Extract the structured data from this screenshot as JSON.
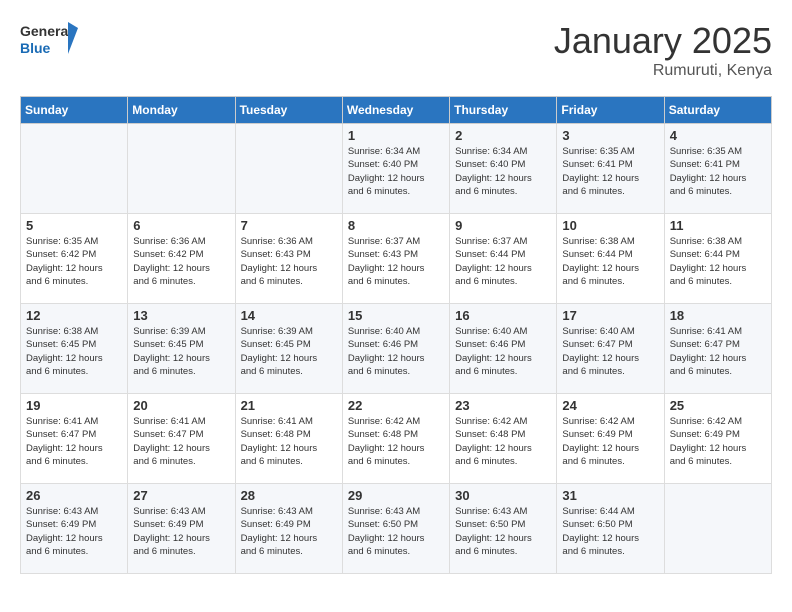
{
  "header": {
    "logo_line1": "General",
    "logo_line2": "Blue",
    "month": "January 2025",
    "location": "Rumuruti, Kenya"
  },
  "days_of_week": [
    "Sunday",
    "Monday",
    "Tuesday",
    "Wednesday",
    "Thursday",
    "Friday",
    "Saturday"
  ],
  "weeks": [
    [
      {
        "day": "",
        "info": ""
      },
      {
        "day": "",
        "info": ""
      },
      {
        "day": "",
        "info": ""
      },
      {
        "day": "1",
        "info": "Sunrise: 6:34 AM\nSunset: 6:40 PM\nDaylight: 12 hours\nand 6 minutes."
      },
      {
        "day": "2",
        "info": "Sunrise: 6:34 AM\nSunset: 6:40 PM\nDaylight: 12 hours\nand 6 minutes."
      },
      {
        "day": "3",
        "info": "Sunrise: 6:35 AM\nSunset: 6:41 PM\nDaylight: 12 hours\nand 6 minutes."
      },
      {
        "day": "4",
        "info": "Sunrise: 6:35 AM\nSunset: 6:41 PM\nDaylight: 12 hours\nand 6 minutes."
      }
    ],
    [
      {
        "day": "5",
        "info": "Sunrise: 6:35 AM\nSunset: 6:42 PM\nDaylight: 12 hours\nand 6 minutes."
      },
      {
        "day": "6",
        "info": "Sunrise: 6:36 AM\nSunset: 6:42 PM\nDaylight: 12 hours\nand 6 minutes."
      },
      {
        "day": "7",
        "info": "Sunrise: 6:36 AM\nSunset: 6:43 PM\nDaylight: 12 hours\nand 6 minutes."
      },
      {
        "day": "8",
        "info": "Sunrise: 6:37 AM\nSunset: 6:43 PM\nDaylight: 12 hours\nand 6 minutes."
      },
      {
        "day": "9",
        "info": "Sunrise: 6:37 AM\nSunset: 6:44 PM\nDaylight: 12 hours\nand 6 minutes."
      },
      {
        "day": "10",
        "info": "Sunrise: 6:38 AM\nSunset: 6:44 PM\nDaylight: 12 hours\nand 6 minutes."
      },
      {
        "day": "11",
        "info": "Sunrise: 6:38 AM\nSunset: 6:44 PM\nDaylight: 12 hours\nand 6 minutes."
      }
    ],
    [
      {
        "day": "12",
        "info": "Sunrise: 6:38 AM\nSunset: 6:45 PM\nDaylight: 12 hours\nand 6 minutes."
      },
      {
        "day": "13",
        "info": "Sunrise: 6:39 AM\nSunset: 6:45 PM\nDaylight: 12 hours\nand 6 minutes."
      },
      {
        "day": "14",
        "info": "Sunrise: 6:39 AM\nSunset: 6:45 PM\nDaylight: 12 hours\nand 6 minutes."
      },
      {
        "day": "15",
        "info": "Sunrise: 6:40 AM\nSunset: 6:46 PM\nDaylight: 12 hours\nand 6 minutes."
      },
      {
        "day": "16",
        "info": "Sunrise: 6:40 AM\nSunset: 6:46 PM\nDaylight: 12 hours\nand 6 minutes."
      },
      {
        "day": "17",
        "info": "Sunrise: 6:40 AM\nSunset: 6:47 PM\nDaylight: 12 hours\nand 6 minutes."
      },
      {
        "day": "18",
        "info": "Sunrise: 6:41 AM\nSunset: 6:47 PM\nDaylight: 12 hours\nand 6 minutes."
      }
    ],
    [
      {
        "day": "19",
        "info": "Sunrise: 6:41 AM\nSunset: 6:47 PM\nDaylight: 12 hours\nand 6 minutes."
      },
      {
        "day": "20",
        "info": "Sunrise: 6:41 AM\nSunset: 6:47 PM\nDaylight: 12 hours\nand 6 minutes."
      },
      {
        "day": "21",
        "info": "Sunrise: 6:41 AM\nSunset: 6:48 PM\nDaylight: 12 hours\nand 6 minutes."
      },
      {
        "day": "22",
        "info": "Sunrise: 6:42 AM\nSunset: 6:48 PM\nDaylight: 12 hours\nand 6 minutes."
      },
      {
        "day": "23",
        "info": "Sunrise: 6:42 AM\nSunset: 6:48 PM\nDaylight: 12 hours\nand 6 minutes."
      },
      {
        "day": "24",
        "info": "Sunrise: 6:42 AM\nSunset: 6:49 PM\nDaylight: 12 hours\nand 6 minutes."
      },
      {
        "day": "25",
        "info": "Sunrise: 6:42 AM\nSunset: 6:49 PM\nDaylight: 12 hours\nand 6 minutes."
      }
    ],
    [
      {
        "day": "26",
        "info": "Sunrise: 6:43 AM\nSunset: 6:49 PM\nDaylight: 12 hours\nand 6 minutes."
      },
      {
        "day": "27",
        "info": "Sunrise: 6:43 AM\nSunset: 6:49 PM\nDaylight: 12 hours\nand 6 minutes."
      },
      {
        "day": "28",
        "info": "Sunrise: 6:43 AM\nSunset: 6:49 PM\nDaylight: 12 hours\nand 6 minutes."
      },
      {
        "day": "29",
        "info": "Sunrise: 6:43 AM\nSunset: 6:50 PM\nDaylight: 12 hours\nand 6 minutes."
      },
      {
        "day": "30",
        "info": "Sunrise: 6:43 AM\nSunset: 6:50 PM\nDaylight: 12 hours\nand 6 minutes."
      },
      {
        "day": "31",
        "info": "Sunrise: 6:44 AM\nSunset: 6:50 PM\nDaylight: 12 hours\nand 6 minutes."
      },
      {
        "day": "",
        "info": ""
      }
    ]
  ]
}
